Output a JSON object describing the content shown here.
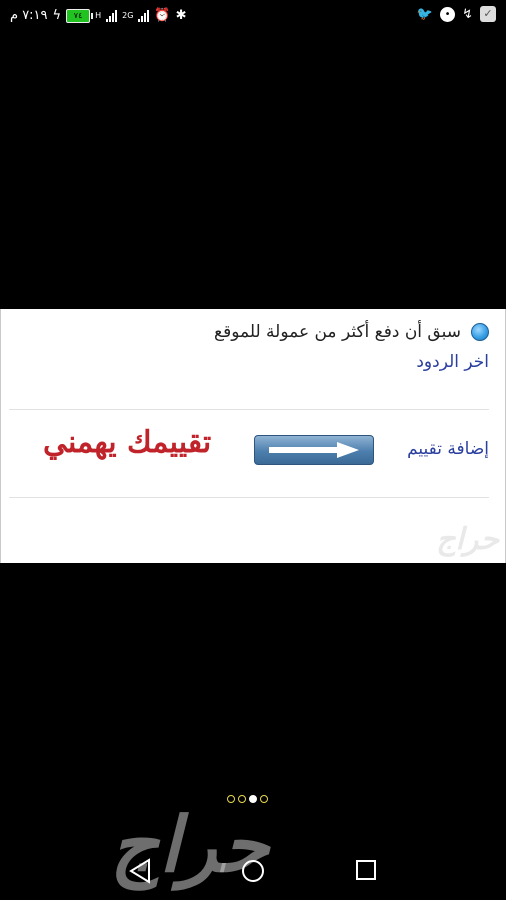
{
  "status_bar": {
    "time": "٧:١٩ م",
    "battery_level": "٧٤",
    "network_small_1": "H",
    "network_small_2": "2G",
    "icons": [
      "alarm-icon",
      "bluetooth-icon",
      "twitter-icon",
      "chat-icon",
      "missed-call-icon",
      "check-app-icon"
    ]
  },
  "post": {
    "line_text": "سبق أن دفع أكثر من عمولة للموقع",
    "latest_replies_link": "اخر الردود",
    "add_rating_link": "إضافة تقييم",
    "rating_matters_text": "تقييمك يهمني",
    "watermark": "حراج"
  },
  "pager": {
    "count": 4,
    "active_index": 2
  },
  "watermark_big": "حراج",
  "navigation": {
    "buttons": [
      "back-icon",
      "home-icon",
      "recents-icon"
    ]
  },
  "colors": {
    "link": "#2a3f9e",
    "accent_red": "#c0232a",
    "battery": "#21c321"
  }
}
